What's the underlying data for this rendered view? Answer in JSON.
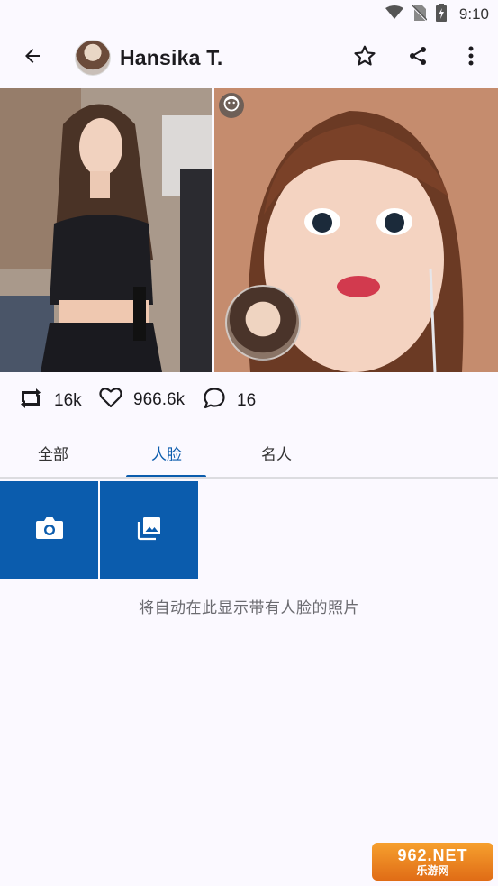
{
  "status_bar": {
    "time": "9:10",
    "icons": [
      "wifi-icon",
      "no-sim-icon",
      "battery-icon"
    ]
  },
  "app_bar": {
    "title": "Hansika T.",
    "actions": [
      "back-arrow-icon",
      "star-outline-icon",
      "share-icon",
      "more-vert-icon"
    ]
  },
  "stats": {
    "reposts": "16k",
    "likes": "966.6k",
    "comments": "16"
  },
  "tabs": [
    {
      "label": "全部",
      "active": false
    },
    {
      "label": "人脸",
      "active": true
    },
    {
      "label": "名人",
      "active": false
    }
  ],
  "tiles": [
    "camera-icon",
    "gallery-icon"
  ],
  "empty_message": "将自动在此显示带有人脸的照片",
  "watermark": {
    "top": "962.NET",
    "bottom": "乐游网"
  },
  "colors": {
    "accent": "#0b5cad",
    "background": "#fbf9ff"
  }
}
